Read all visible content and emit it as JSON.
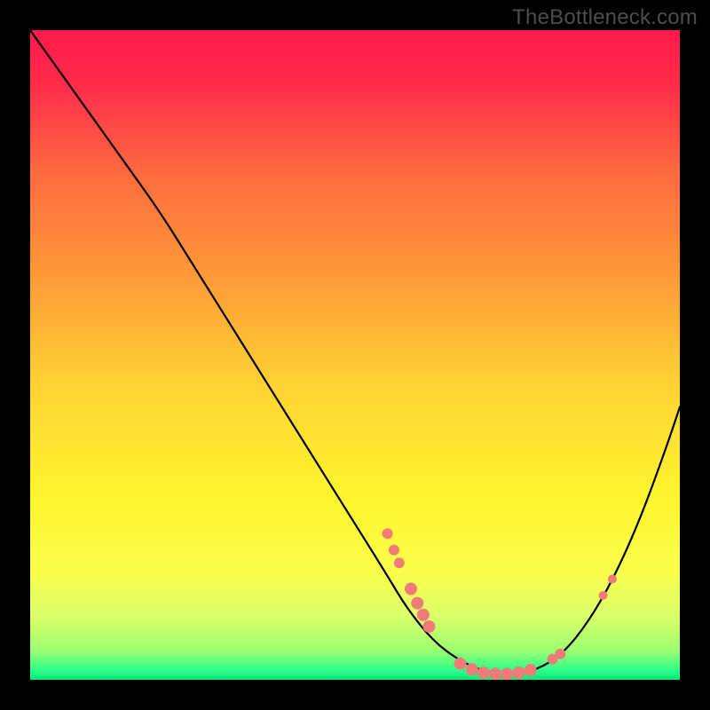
{
  "attribution": "TheBottleneck.com",
  "gradient_stops": [
    {
      "offset": 0,
      "color": "#ff1a4b"
    },
    {
      "offset": 0.08,
      "color": "#ff2b4a"
    },
    {
      "offset": 0.22,
      "color": "#ff6a3f"
    },
    {
      "offset": 0.38,
      "color": "#ff9a38"
    },
    {
      "offset": 0.55,
      "color": "#ffd433"
    },
    {
      "offset": 0.72,
      "color": "#fff52f"
    },
    {
      "offset": 0.83,
      "color": "#fbff4a"
    },
    {
      "offset": 0.9,
      "color": "#dcff6a"
    },
    {
      "offset": 0.955,
      "color": "#9cff70"
    },
    {
      "offset": 0.985,
      "color": "#2fff8a"
    },
    {
      "offset": 1.0,
      "color": "#08e57a"
    }
  ],
  "chart_data": {
    "type": "line",
    "title": "",
    "xlabel": "",
    "ylabel": "",
    "xlim": [
      0,
      100
    ],
    "ylim": [
      0,
      100
    ],
    "series": [
      {
        "name": "bottleneck-curve",
        "x": [
          0,
          5,
          10,
          15,
          20,
          25,
          30,
          35,
          40,
          45,
          50,
          55,
          58,
          62,
          66,
          70,
          74,
          78,
          82,
          86,
          90,
          94,
          98,
          100
        ],
        "y": [
          100,
          93,
          86,
          79,
          72,
          64,
          56,
          48,
          40,
          32,
          24,
          16,
          11,
          6,
          3,
          1.2,
          0.8,
          1.5,
          4,
          9,
          16,
          25,
          36,
          42
        ]
      }
    ],
    "markers": {
      "name": "highlighted-points",
      "color": "#f07b78",
      "points": [
        {
          "x": 55.0,
          "y": 22.5,
          "r": 6
        },
        {
          "x": 56.0,
          "y": 20.0,
          "r": 6
        },
        {
          "x": 56.8,
          "y": 18.0,
          "r": 6
        },
        {
          "x": 58.6,
          "y": 14.0,
          "r": 7
        },
        {
          "x": 59.6,
          "y": 11.8,
          "r": 7
        },
        {
          "x": 60.5,
          "y": 10.0,
          "r": 7
        },
        {
          "x": 61.4,
          "y": 8.2,
          "r": 7
        },
        {
          "x": 66.2,
          "y": 2.5,
          "r": 7
        },
        {
          "x": 68.0,
          "y": 1.6,
          "r": 7
        },
        {
          "x": 69.8,
          "y": 1.1,
          "r": 7
        },
        {
          "x": 71.6,
          "y": 0.9,
          "r": 7
        },
        {
          "x": 73.4,
          "y": 0.9,
          "r": 7
        },
        {
          "x": 75.2,
          "y": 1.1,
          "r": 7
        },
        {
          "x": 77.0,
          "y": 1.5,
          "r": 7
        },
        {
          "x": 80.4,
          "y": 3.2,
          "r": 6
        },
        {
          "x": 81.6,
          "y": 4.0,
          "r": 6
        },
        {
          "x": 88.2,
          "y": 13.0,
          "r": 5
        },
        {
          "x": 89.6,
          "y": 15.5,
          "r": 5
        }
      ]
    }
  }
}
